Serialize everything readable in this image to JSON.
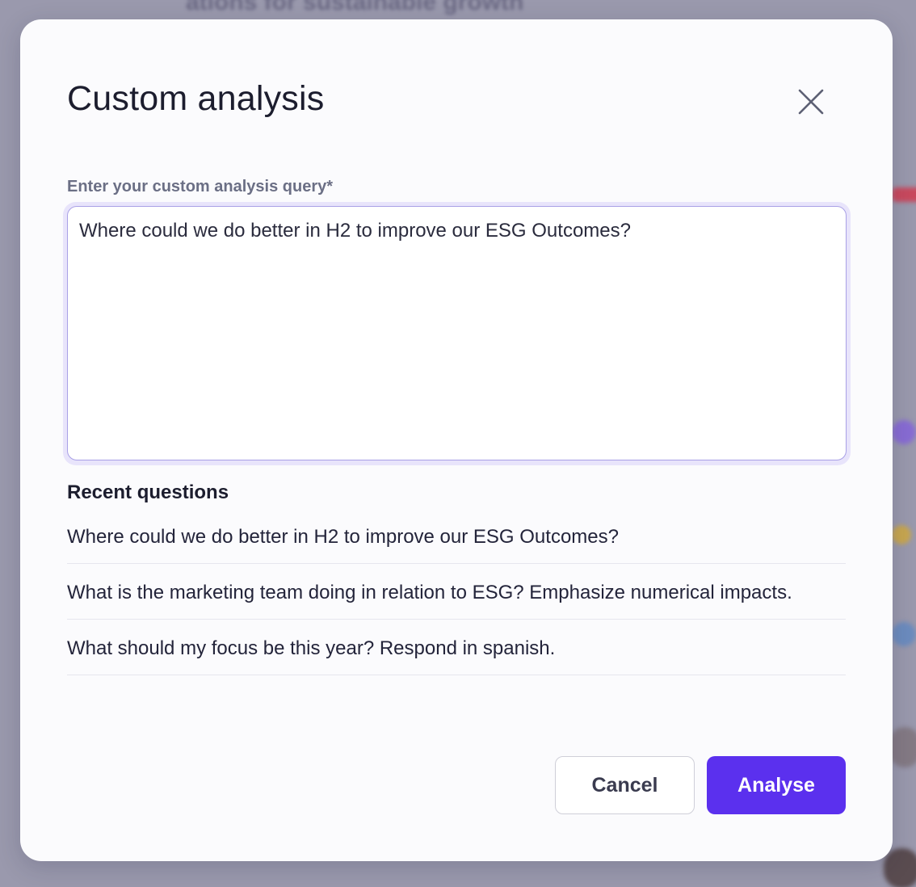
{
  "background": {
    "heading_text": "ations for sustainable growth"
  },
  "modal": {
    "title": "Custom analysis",
    "close_icon": "close-icon",
    "query_label": "Enter your custom analysis query*",
    "query_value": "Where could we do better in H2 to improve our ESG Outcomes?",
    "recent_title": "Recent questions",
    "recent_questions": [
      "Where could we do better in H2 to improve our ESG Outcomes?",
      "What is the marketing team doing in relation to ESG? Emphasize numerical impacts.",
      "What should my focus be this year? Respond in spanish."
    ],
    "cancel_label": "Cancel",
    "analyse_label": "Analyse"
  },
  "colors": {
    "accent": "#5b30ee",
    "input_border": "#a9a0e6",
    "label": "#6b6f85"
  }
}
